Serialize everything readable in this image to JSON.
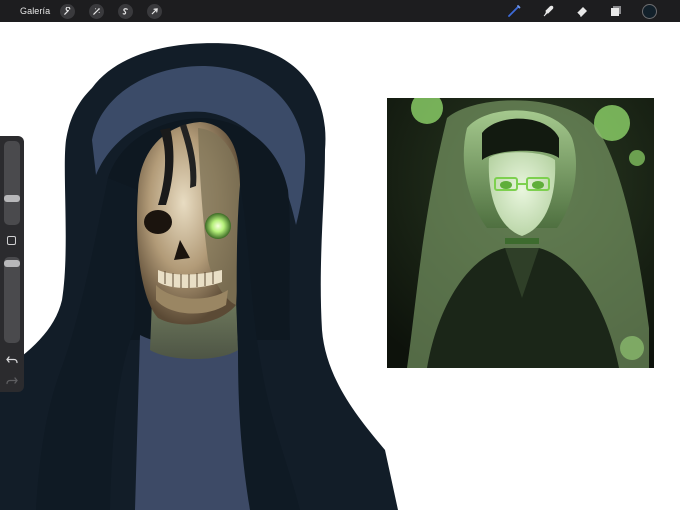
{
  "toolbar": {
    "gallery_label": "Galería",
    "left_tools": [
      "wrench-icon",
      "magic-wand-icon",
      "selection-icon",
      "transform-arrow-icon"
    ],
    "right_tools": [
      "brush-icon",
      "smudge-icon",
      "eraser-icon",
      "layers-icon"
    ],
    "current_color": "#12202a",
    "active_tool_color": "#3d6bd8"
  },
  "palette": {
    "hood_dark": "#121d28",
    "hood_band": "#3b4b68",
    "shirt": "#3d4a66",
    "reference_green": "#8fd46a"
  }
}
